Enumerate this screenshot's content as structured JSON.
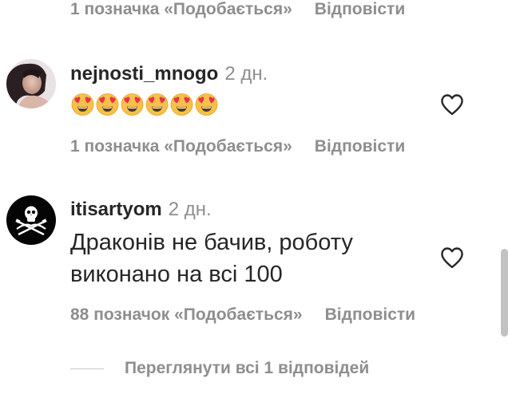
{
  "top_meta": {
    "likes": "1 позначка «Подобається»",
    "reply": "Відповісти"
  },
  "comments": [
    {
      "username": "nejnosti_mnogo",
      "age": "2 дн.",
      "body_emoji": "😍😍😍😍😍😍",
      "emoji_count": 6,
      "likes": "1 позначка «Подобається»",
      "reply": "Відповісти"
    },
    {
      "username": "itisartyom",
      "age": "2 дн.",
      "body_lines": [
        "Драконів не бачив, роботу",
        "виконано на всі 100"
      ],
      "likes": "88 позначок «Подобається»",
      "reply": "Відповісти"
    }
  ],
  "view_replies": "Переглянути всі 1 відповідей",
  "colors": {
    "text": "#262626",
    "secondary": "#8e8e8e",
    "divider": "#c7c7c7"
  },
  "icons": {
    "like": "heart-outline-icon",
    "emoji": "heart-eyes-emoji-icon",
    "pirate": "jolly-roger-icon"
  }
}
